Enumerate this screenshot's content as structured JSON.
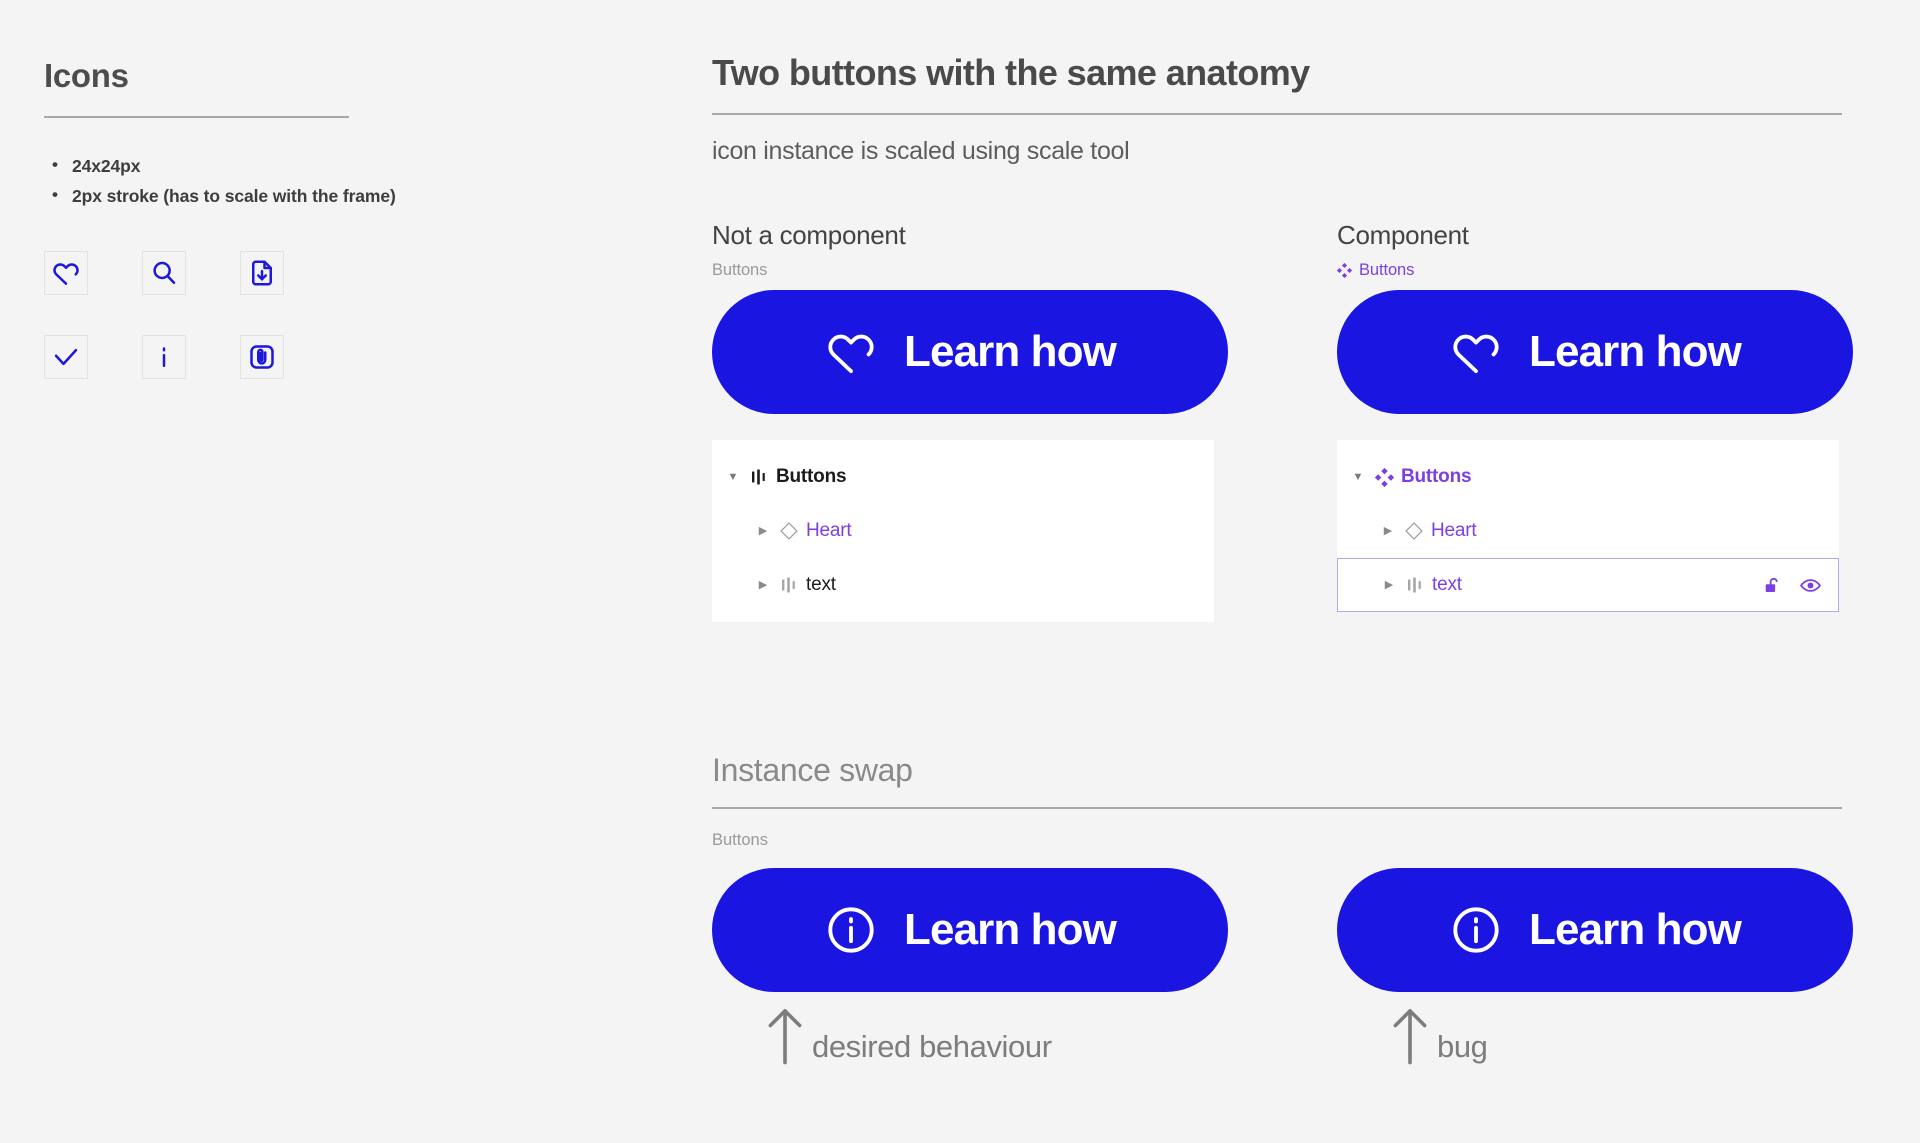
{
  "left_panel": {
    "title": "Icons",
    "bullets": [
      "24x24px",
      "2px stroke (has to scale with the frame)"
    ],
    "icons": [
      [
        {
          "name": "heart-icon",
          "label": "heart"
        },
        {
          "name": "search-icon",
          "label": "search"
        },
        {
          "name": "file-download-icon",
          "label": "file-download"
        }
      ],
      [
        {
          "name": "check-icon",
          "label": "check"
        },
        {
          "name": "info-letter-icon",
          "label": "info"
        },
        {
          "name": "attachment-icon",
          "label": "attachment"
        }
      ]
    ]
  },
  "main": {
    "title": "Two buttons with the same anatomy",
    "subtitle": "icon instance is scaled using scale tool",
    "columns": [
      {
        "heading": "Not a component",
        "sublabel": "Buttons",
        "sublabel_icon": "none",
        "button": {
          "label": "Learn how",
          "icon": "heart-icon",
          "color": "#1a15e0"
        },
        "layers": [
          {
            "name": "Buttons",
            "icon": "auto-layout-icon",
            "indent": 0,
            "color": "dark",
            "bold": true,
            "caret": "down",
            "selected": false
          },
          {
            "name": "Heart",
            "icon": "instance-diamond-icon",
            "indent": 1,
            "color": "purple",
            "bold": false,
            "caret": "right",
            "selected": false
          },
          {
            "name": "text",
            "icon": "auto-layout-icon",
            "indent": 1,
            "color": "dark",
            "bold": false,
            "caret": "right",
            "selected": false
          }
        ]
      },
      {
        "heading": "Component",
        "sublabel": "Buttons",
        "sublabel_icon": "component-icon",
        "button": {
          "label": "Learn how",
          "icon": "heart-icon",
          "color": "#1a15e0"
        },
        "layers": [
          {
            "name": "Buttons",
            "icon": "component-icon",
            "indent": 0,
            "color": "purple",
            "bold": true,
            "caret": "down",
            "selected": false
          },
          {
            "name": "Heart",
            "icon": "instance-diamond-icon",
            "indent": 1,
            "color": "purple",
            "bold": false,
            "caret": "right",
            "selected": false
          },
          {
            "name": "text",
            "icon": "auto-layout-icon",
            "indent": 1,
            "color": "purple",
            "bold": false,
            "caret": "right",
            "selected": true,
            "actions": [
              "unlock-icon",
              "eye-icon"
            ]
          }
        ]
      }
    ],
    "instance_swap": {
      "title": "Instance swap",
      "sublabel": "Buttons",
      "buttons": [
        {
          "label": "Learn how",
          "icon": "info-circle-icon",
          "color": "#1a15e0"
        },
        {
          "label": "Learn how",
          "icon": "info-circle-icon",
          "color": "#1a15e0"
        }
      ],
      "annotations": [
        {
          "arrow": "arrow-up-icon",
          "text": "desired behaviour"
        },
        {
          "arrow": "arrow-up-icon",
          "text": "bug"
        }
      ]
    }
  },
  "colors": {
    "background": "#f4f4f4",
    "button_blue": "#1a15e0",
    "component_purple": "#7b3fe4",
    "rule_gray": "#a8a8a8",
    "heading_gray": "#4a4a4a"
  }
}
